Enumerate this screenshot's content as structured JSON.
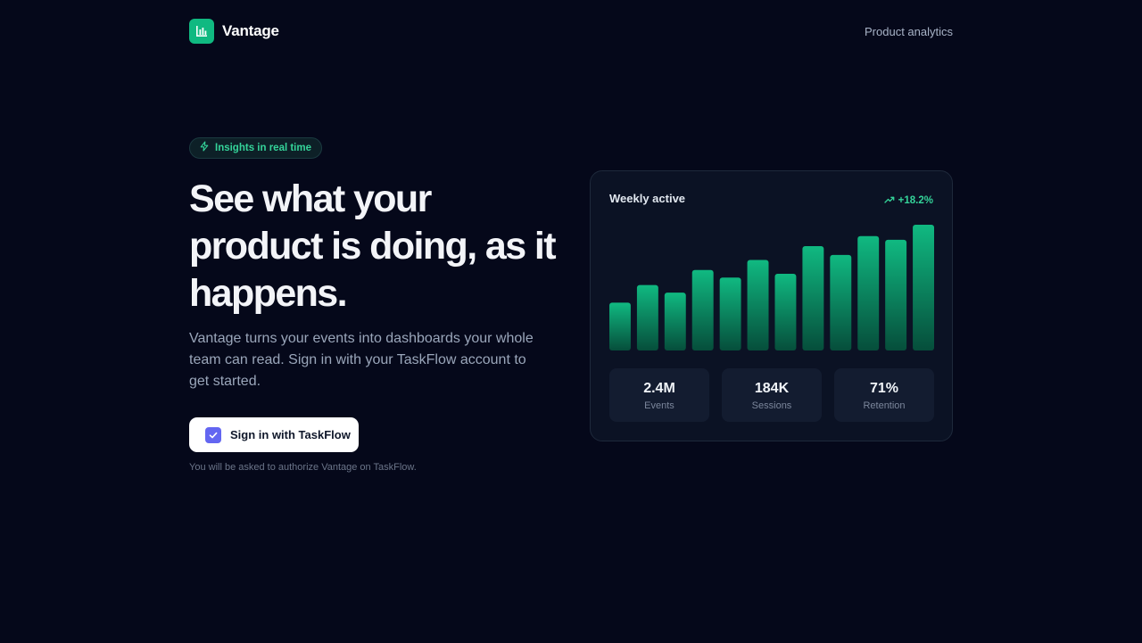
{
  "brand": {
    "name": "Vantage",
    "logo_icon": "bar-chart-icon",
    "accent": "#10b981"
  },
  "nav": {
    "link": "Product analytics"
  },
  "badge": {
    "icon": "bolt-icon",
    "text": "Insights in real time"
  },
  "hero": {
    "headline": "See what your product is doing, as it happens.",
    "subtext": "Vantage turns your events into dashboards your whole team can read. Sign in with your TaskFlow account to get started.",
    "cta_label": "Sign in with TaskFlow",
    "cta_icon": "check-square-icon",
    "cta_color": "#6366f1",
    "note": "You will be asked to authorize Vantage on TaskFlow."
  },
  "card": {
    "title": "Weekly active",
    "trend": "+18.2%",
    "trend_icon": "trending-up-icon",
    "stats": [
      {
        "value": "2.4M",
        "label": "Events"
      },
      {
        "value": "184K",
        "label": "Sessions"
      },
      {
        "value": "71%",
        "label": "Retention"
      }
    ]
  },
  "chart_data": {
    "type": "bar",
    "values": [
      38,
      52,
      46,
      64,
      58,
      72,
      61,
      83,
      76,
      91,
      88,
      100
    ],
    "ylim": [
      0,
      100
    ],
    "color_top": "#10b981",
    "color_bottom": "#064e3b"
  }
}
